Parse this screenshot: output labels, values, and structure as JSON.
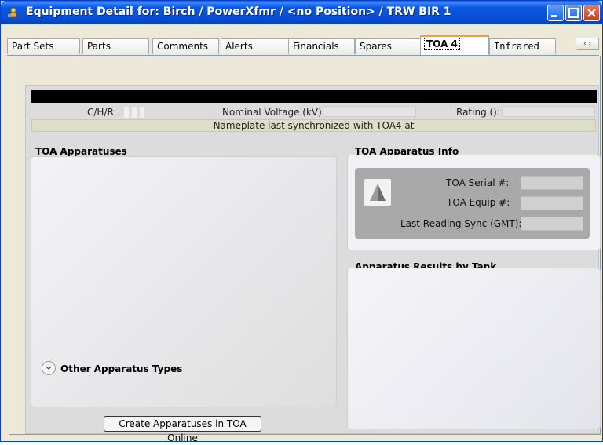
{
  "window": {
    "title": "Equipment Detail for:  Birch / PowerXfmr / <no Position> / TRW BIR 1"
  },
  "tabs": [
    {
      "label": "Part Sets"
    },
    {
      "label": "Parts"
    },
    {
      "label": "Comments"
    },
    {
      "label": "Alerts"
    },
    {
      "label": "Financials"
    },
    {
      "label": "Spares"
    },
    {
      "label": "TOA 4",
      "active": true
    },
    {
      "label": "Infrared"
    }
  ],
  "tab_scroll": {
    "label": "‹ ›"
  },
  "header": {
    "chr_label": "C/H/R:",
    "nominal_voltage_label": "Nominal Voltage (kV):",
    "nominal_voltage_value": "",
    "rating_label": "Rating ():",
    "rating_value": "",
    "sync_text": "Nameplate last synchronized with TOA4 at"
  },
  "toa_apparatuses": {
    "title": "TOA Apparatuses",
    "other_types_label": "Other Apparatus Types"
  },
  "toa_info": {
    "title": "TOA Apparatus Info",
    "serial_label": "TOA Serial #:",
    "serial_value": "",
    "equip_label": "TOA Equip #:",
    "equip_value": "",
    "last_sync_label": "Last Reading Sync (GMT):",
    "last_sync_value": ""
  },
  "results": {
    "title": "Apparatus Results by Tank"
  },
  "actions": {
    "create_label": "Create Apparatuses in TOA Online"
  },
  "colors": {
    "titlebar": "#0b56e0",
    "active_tab_accent": "#e8a33a",
    "panel_bg": "#dcdcdc",
    "info_inner": "#a9a9a9"
  }
}
